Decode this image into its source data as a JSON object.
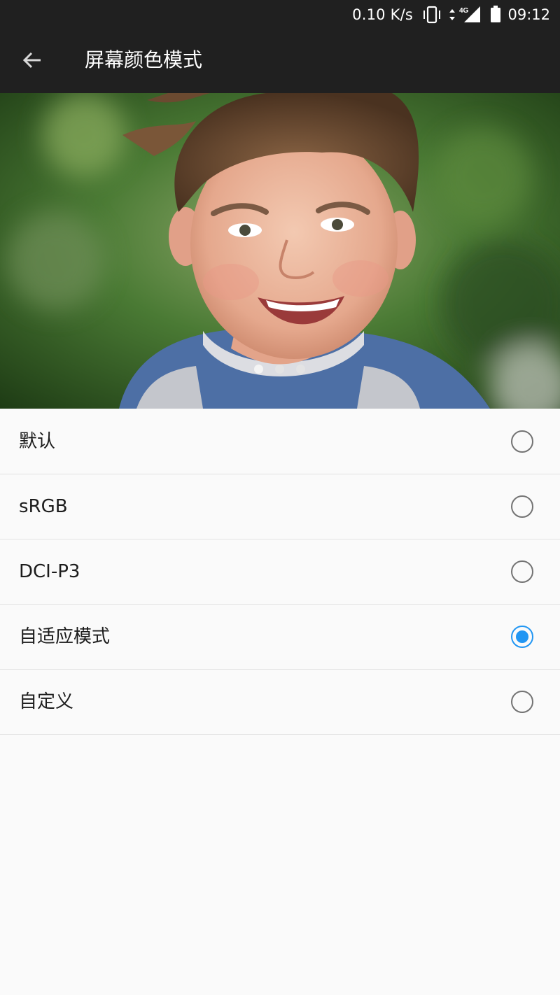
{
  "status_bar": {
    "network_speed": "0.10 K/s",
    "network_type": "4G",
    "time": "09:12",
    "icons": [
      "vibrate-icon",
      "data-arrows-icon",
      "signal-icon",
      "battery-icon"
    ]
  },
  "toolbar": {
    "back_icon": "arrow-back-icon",
    "title": "屏幕颜色模式"
  },
  "preview": {
    "page_count": 3,
    "current_page": 1
  },
  "options": [
    {
      "label": "默认",
      "selected": false
    },
    {
      "label": "sRGB",
      "selected": false
    },
    {
      "label": "DCI-P3",
      "selected": false
    },
    {
      "label": "自适应模式",
      "selected": true
    },
    {
      "label": "自定义",
      "selected": false
    }
  ],
  "colors": {
    "bar_bg": "#202020",
    "accent": "#2196f3",
    "page_bg": "#fafafa"
  }
}
